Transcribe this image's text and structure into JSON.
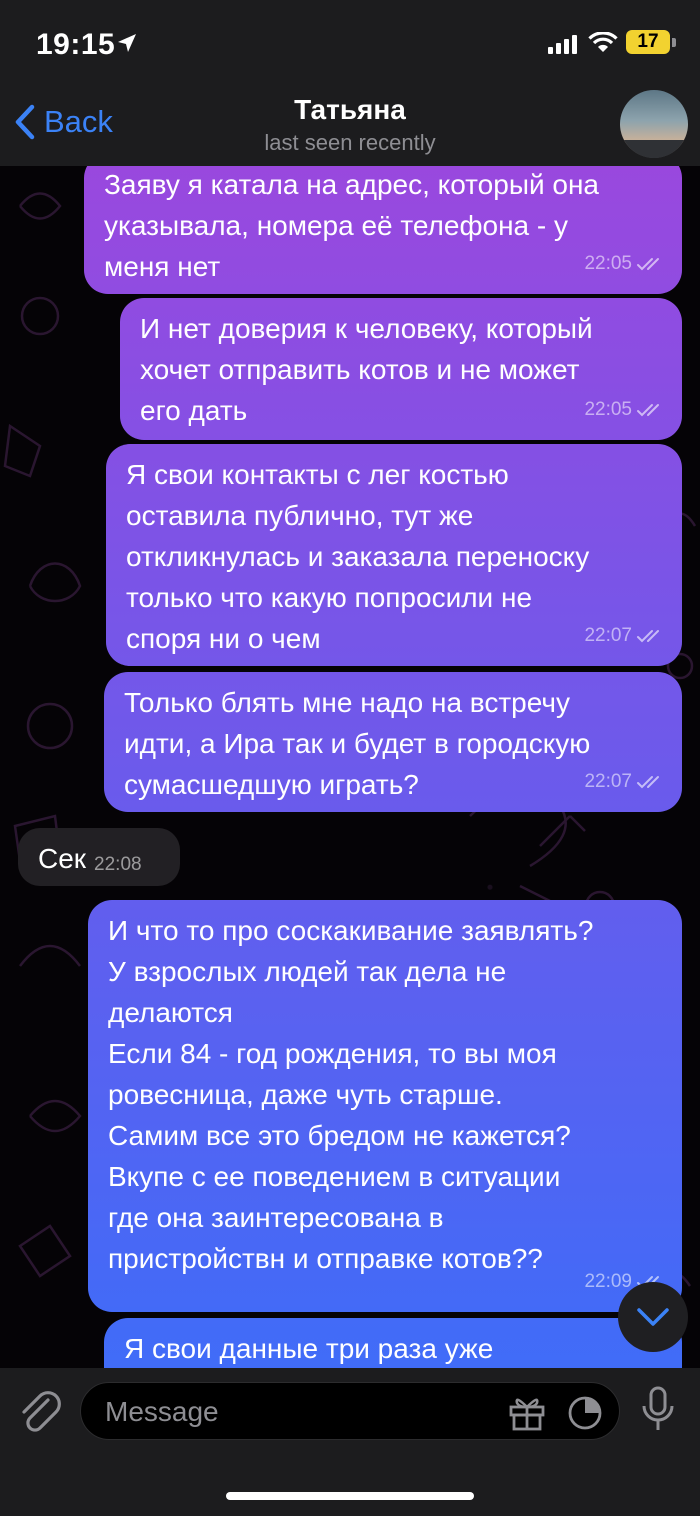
{
  "status_bar": {
    "time": "19:15",
    "battery": "17",
    "icons": [
      "location-arrow-icon",
      "signal-icon",
      "wifi-icon",
      "battery-icon"
    ]
  },
  "header": {
    "back_label": "Back",
    "contact_name": "Татьяна",
    "contact_status": "last seen recently"
  },
  "messages": [
    {
      "direction": "out",
      "text": "Заяву я катала на адрес, который она\nуказывала, номера её телефона - у\nменя нет",
      "time": "22:05",
      "read": true
    },
    {
      "direction": "out",
      "text": "И нет доверия к человеку, который\nхочет отправить котов и не может\nего дать",
      "time": "22:05",
      "read": true
    },
    {
      "direction": "out",
      "text": "Я свои контакты с лег костью\nоставила публично, тут же\nоткликнулась и заказала переноску\nтолько что какую попросили не\nспоря ни о чем",
      "time": "22:07",
      "read": true
    },
    {
      "direction": "out",
      "text": "Только блять мне надо на встречу\nидти, а Ира так и будет в городскую\nсумасшедшую играть?",
      "time": "22:07",
      "read": true
    },
    {
      "direction": "in",
      "text": "Сек",
      "time": "22:08"
    },
    {
      "direction": "out",
      "text": "И что то про соскакивание заявлять?\nУ взрослых людей так дела не\nделаются\nЕсли 84 - год рождения, то вы моя\nровесница, даже чуть старше.\nСамим все это бредом не кажется?\nВкупе с ее поведением в ситуации\nгде она заинтересована в\nпристройствн и отправке котов??",
      "time": "22:09",
      "read": true
    },
    {
      "direction": "out",
      "text": "Я свои данные три раза уже",
      "time": "",
      "read": false
    }
  ],
  "input": {
    "placeholder": "Message"
  },
  "colors": {
    "bubble_top": "#9a48de",
    "bubble_bottom": "#3f6cf8",
    "accent": "#3b82f6"
  }
}
